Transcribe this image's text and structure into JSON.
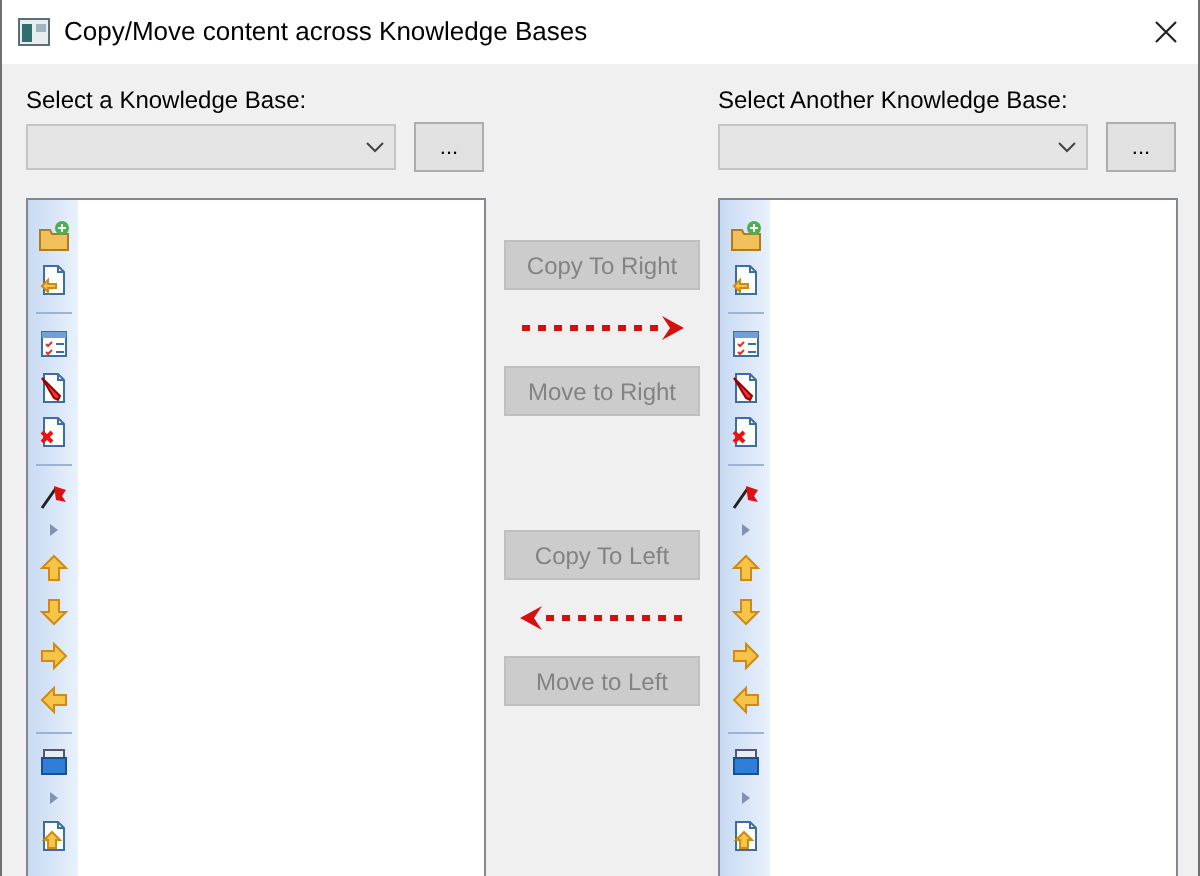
{
  "window": {
    "title": "Copy/Move content across Knowledge Bases"
  },
  "left": {
    "label": "Select a Knowledge Base:",
    "browse": "..."
  },
  "right": {
    "label": "Select Another Knowledge Base:",
    "browse": "..."
  },
  "actions": [
    {
      "label": "Copy To Right",
      "disabled": true,
      "kind": "right"
    },
    {
      "label": "Move to Right",
      "disabled": true
    },
    {
      "label": "Copy To Left",
      "disabled": true,
      "kind": "left"
    },
    {
      "label": "Move to Left",
      "disabled": true
    }
  ]
}
